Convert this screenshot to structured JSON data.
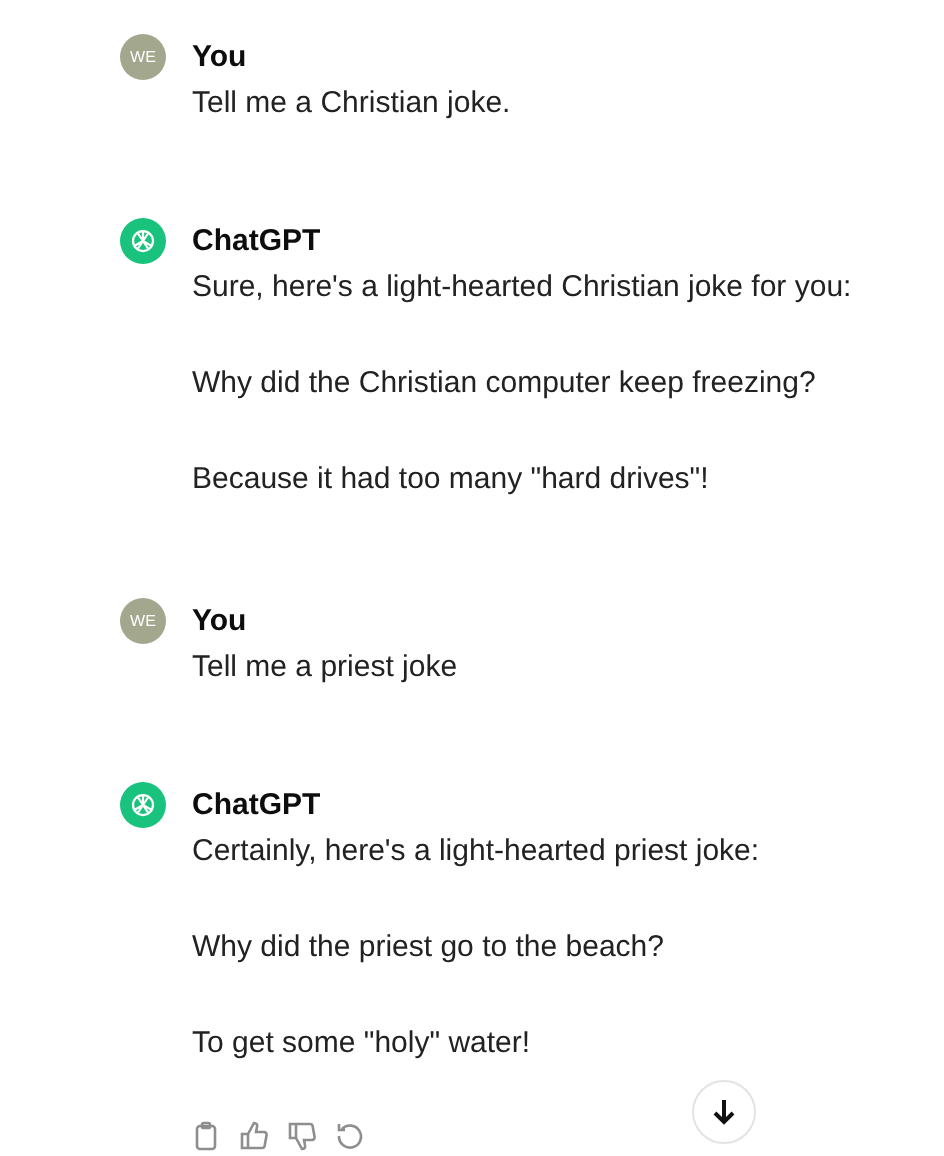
{
  "messages": [
    {
      "kind": "user",
      "avatar": "WE",
      "author": "You",
      "paragraphs": [
        "Tell me a Christian joke."
      ]
    },
    {
      "kind": "assistant",
      "author": "ChatGPT",
      "paragraphs": [
        "Sure, here's a light-hearted Christian joke for you:",
        "Why did the Christian computer keep freezing?",
        "Because it had too many \"hard drives\"!"
      ]
    },
    {
      "kind": "user",
      "avatar": "WE",
      "author": "You",
      "paragraphs": [
        "Tell me a priest joke"
      ]
    },
    {
      "kind": "assistant",
      "author": "ChatGPT",
      "paragraphs": [
        "Certainly, here's a light-hearted priest joke:",
        "Why did the priest go to the beach?",
        "To get some \"holy\" water!"
      ],
      "actions": true
    }
  ]
}
